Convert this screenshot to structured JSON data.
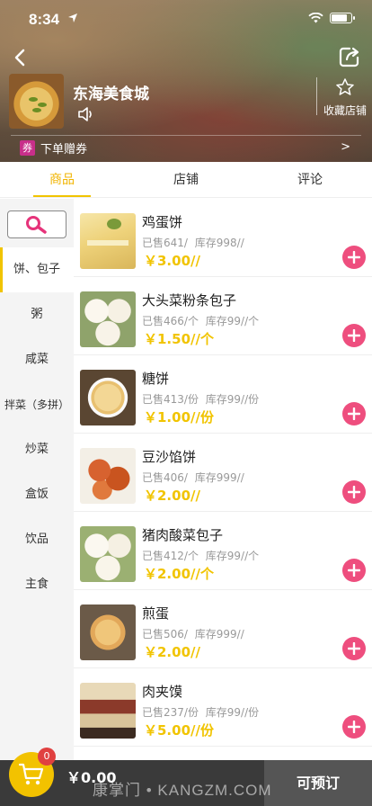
{
  "status_bar": {
    "time": "8:34"
  },
  "store": {
    "name": "东海美食城",
    "favorite_label": "收藏店铺",
    "promo_badge": "券",
    "promo_text": "下单赠券",
    "promo_arrow": ">"
  },
  "tabs": [
    {
      "label": "商品",
      "active": true
    },
    {
      "label": "店铺",
      "active": false
    },
    {
      "label": "评论",
      "active": false
    }
  ],
  "categories": [
    {
      "label": "饼、包子",
      "active": true
    },
    {
      "label": "粥",
      "active": false
    },
    {
      "label": "咸菜",
      "active": false
    },
    {
      "label": "拌菜（多拼）",
      "active": false
    },
    {
      "label": "炒菜",
      "active": false
    },
    {
      "label": "盒饭",
      "active": false
    },
    {
      "label": "饮品",
      "active": false
    },
    {
      "label": "主食",
      "active": false
    }
  ],
  "products": [
    {
      "name": "鸡蛋饼",
      "sold": "已售641/",
      "stock": "库存998//",
      "price": "￥3.00//"
    },
    {
      "name": "大头菜粉条包子",
      "sold": "已售466/个",
      "stock": "库存99//个",
      "price": "￥1.50//个"
    },
    {
      "name": "糖饼",
      "sold": "已售413/份",
      "stock": "库存99//份",
      "price": "￥1.00//份"
    },
    {
      "name": "豆沙馅饼",
      "sold": "已售406/",
      "stock": "库存999//",
      "price": "￥2.00//"
    },
    {
      "name": "猪肉酸菜包子",
      "sold": "已售412/个",
      "stock": "库存99//个",
      "price": "￥2.00//个"
    },
    {
      "name": "煎蛋",
      "sold": "已售506/",
      "stock": "库存999//",
      "price": "￥2.00//"
    },
    {
      "name": "肉夹馍",
      "sold": "已售237/份",
      "stock": "库存99//份",
      "price": "￥5.00//份"
    }
  ],
  "cart": {
    "count": "0",
    "total": "￥0.00",
    "checkout_label": "可预订"
  },
  "watermark": "康掌门 • KANGZM.COM",
  "colors": {
    "accent": "#f1c400",
    "add_button": "#ee4e7e",
    "bottom_bar": "#3a3a3a"
  }
}
